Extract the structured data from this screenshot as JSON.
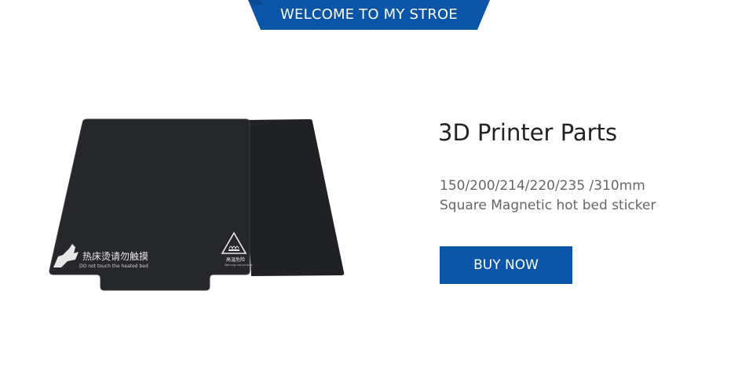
{
  "banner": {
    "text": "WELCOME TO MY STROE"
  },
  "product": {
    "title": "3D Printer Parts",
    "sizes": "150/200/214/220/235 /310mm",
    "description": "Square Magnetic hot bed sticker",
    "sticker_warning_cn": "热床烫请勿触摸",
    "sticker_warning_en": "DO not touch the heated bed",
    "triangle_label": "高温危险",
    "triangle_sublabel": "Warning hot surface"
  },
  "buy_button": {
    "label": "BUY NOW"
  },
  "colors": {
    "accent": "#0a55a8",
    "plate": "#1e1f23"
  }
}
